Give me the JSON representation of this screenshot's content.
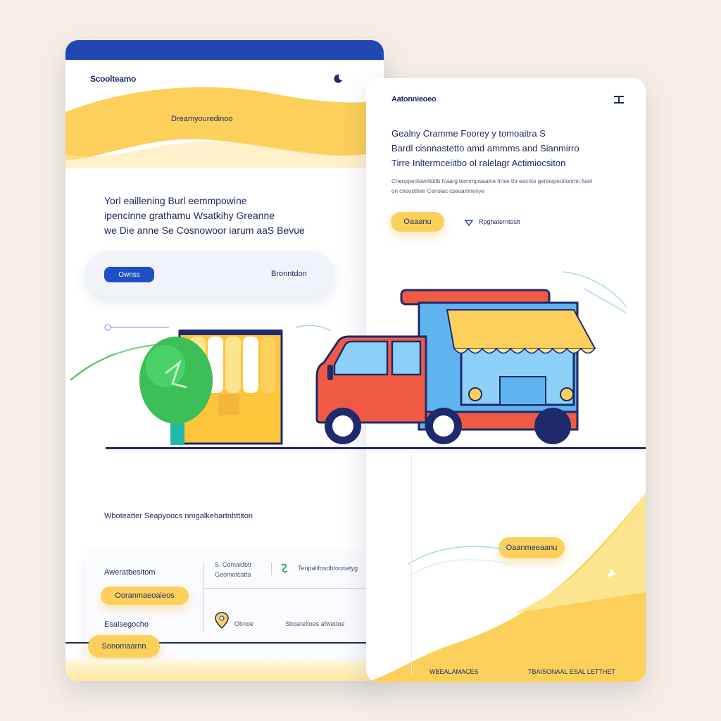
{
  "left_panel": {
    "brand": "Scoolteamo",
    "banner_text": "Dreamyouredinoo",
    "headline": [
      "Yorl eaillening Burl eemmpowine",
      "ipencinne grathamu Wsatkihy Greanne",
      "we Die anne Se Cosnowoor iarum aaS Bevue"
    ],
    "search_button": "Ownss",
    "search_link": "Bronntdon",
    "section_caption": "Wboteatter Seapyoocs nmgalkehartnhttiton",
    "info_panel": {
      "title": "Aweratbesitom",
      "cta": "Ooranmaeoaieos",
      "sub": "Esalsegocho",
      "bottom_button": "Sonomaarnn",
      "item1_title": "S. Comaldbtr",
      "item1_sub": "Geomotcatta",
      "item2": "Tenpalifosdbtoonatyg",
      "item3": "Obnoe",
      "item4": "Sboareltoes afwedoe"
    }
  },
  "right_panel": {
    "brand": "Aatonnieoeo",
    "menu_icon": "menu-icon",
    "headline": [
      "Gealny Cramme Foorey y tomoaitra S",
      "Bardl cisnnastetto amd ammms and Sianmirro",
      "Tirre Inltermceiitbo ol ralelagr Actimiocsiton"
    ],
    "description": [
      "Cnenppentowrtiotfb fcaarg bemmpwaalne fmse thr eacnto gennepeottonmn fueri",
      "on cneoothen Cenolac cseoamnenye"
    ],
    "cta": "Oaaanu",
    "secondary": "Rpghaterntoslt",
    "float_button": "Oaanmeeaanu",
    "footer_left": "WBEALAMACES",
    "footer_right": "TBAISONAAL ESAL LETTHET"
  },
  "colors": {
    "primary_blue": "#1f4fc7",
    "navy": "#1e2a6b",
    "accent_yellow": "#fcd05a",
    "background": "#f6eee6",
    "truck_red": "#f05a44",
    "tree_green": "#3cbf57"
  }
}
